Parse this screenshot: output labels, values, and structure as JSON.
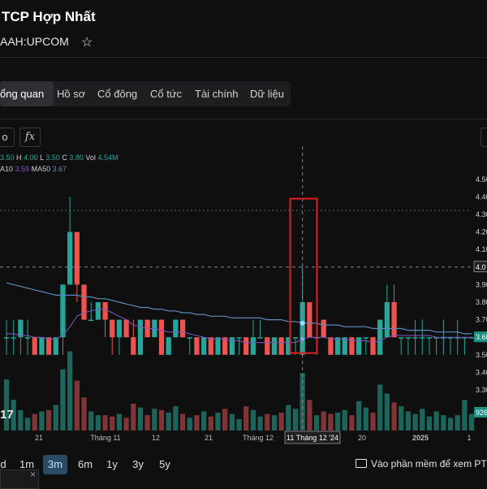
{
  "header": {
    "company_name": "TCP Hợp Nhất",
    "ticker": "AAH:UPCOM",
    "star_icon": "star-outline-icon"
  },
  "tabs": [
    {
      "label": "ổng quan",
      "active": true
    },
    {
      "label": "Hồ sơ",
      "active": false
    },
    {
      "label": "Cổ đông",
      "active": false
    },
    {
      "label": "Cổ tức",
      "active": false
    },
    {
      "label": "Tài chính",
      "active": false
    },
    {
      "label": "Dữ liệu",
      "active": false
    }
  ],
  "toolbar": {
    "left_button": "o",
    "fx_button": "fx"
  },
  "legend": {
    "o_label": "O",
    "o": "3.50",
    "h_label": "H",
    "h": "4.00",
    "l_label": "L",
    "l": "3.50",
    "c_label": "C",
    "c": "3.80",
    "vol_label": "Vol",
    "vol": "4.54M",
    "ma10_label": "A10",
    "ma10": "3.59",
    "ma50_label": "MA50",
    "ma50": "3.67"
  },
  "colors": {
    "up": "#26a69a",
    "down": "#ef5350",
    "ma10": "#7e57c2",
    "ma50": "#5c8ab8",
    "highlight": "#e02020"
  },
  "chart_data": {
    "type": "candlestick",
    "price_axis_ticks": [
      "4.50",
      "4.40",
      "4.30",
      "4.20",
      "4.10",
      "4.00",
      "3.90",
      "3.80",
      "3.70",
      "3.60",
      "3.50",
      "3.40",
      "3.30"
    ],
    "current_price_label": "3.60",
    "crosshair_price_label": "4.0",
    "volume_last_label": "926",
    "time_labels": [
      "21",
      "Tháng 11",
      "12",
      "21",
      "Tháng 12",
      "11 Tháng 12 '24",
      "20",
      "2025",
      "1"
    ],
    "crosshair_date": "11 Tháng 12 '24",
    "ylim": [
      3.3,
      4.55
    ],
    "candles": [
      {
        "o": 3.6,
        "h": 3.7,
        "l": 3.5,
        "c": 3.6,
        "v": 4.0
      },
      {
        "o": 3.6,
        "h": 3.7,
        "l": 3.5,
        "c": 3.6,
        "v": 2.4
      },
      {
        "o": 3.6,
        "h": 3.7,
        "l": 3.5,
        "c": 3.7,
        "v": 1.6
      },
      {
        "o": 3.6,
        "h": 3.7,
        "l": 3.5,
        "c": 3.6,
        "v": 1.0
      },
      {
        "o": 3.6,
        "h": 3.6,
        "l": 3.5,
        "c": 3.5,
        "v": 1.3
      },
      {
        "o": 3.5,
        "h": 3.6,
        "l": 3.5,
        "c": 3.6,
        "v": 1.5
      },
      {
        "o": 3.6,
        "h": 3.6,
        "l": 3.5,
        "c": 3.5,
        "v": 1.6
      },
      {
        "o": 3.5,
        "h": 3.6,
        "l": 3.5,
        "c": 3.6,
        "v": 2.0
      },
      {
        "o": 3.6,
        "h": 3.9,
        "l": 3.5,
        "c": 3.9,
        "v": 4.8
      },
      {
        "o": 3.9,
        "h": 4.4,
        "l": 3.9,
        "c": 4.2,
        "v": 6.2
      },
      {
        "o": 4.2,
        "h": 4.2,
        "l": 3.8,
        "c": 3.9,
        "v": 3.9
      },
      {
        "o": 3.9,
        "h": 3.9,
        "l": 3.7,
        "c": 3.7,
        "v": 2.6
      },
      {
        "o": 3.7,
        "h": 3.8,
        "l": 3.7,
        "c": 3.7,
        "v": 1.5
      },
      {
        "o": 3.7,
        "h": 3.8,
        "l": 3.7,
        "c": 3.8,
        "v": 1.2
      },
      {
        "o": 3.8,
        "h": 3.8,
        "l": 3.6,
        "c": 3.7,
        "v": 1.2
      },
      {
        "o": 3.7,
        "h": 3.7,
        "l": 3.5,
        "c": 3.6,
        "v": 1.1
      },
      {
        "o": 3.6,
        "h": 3.7,
        "l": 3.5,
        "c": 3.7,
        "v": 1.3
      },
      {
        "o": 3.7,
        "h": 3.7,
        "l": 3.6,
        "c": 3.6,
        "v": 1.0
      },
      {
        "o": 3.6,
        "h": 3.7,
        "l": 3.5,
        "c": 3.5,
        "v": 2.1
      },
      {
        "o": 3.5,
        "h": 3.7,
        "l": 3.5,
        "c": 3.7,
        "v": 1.8
      },
      {
        "o": 3.7,
        "h": 3.7,
        "l": 3.6,
        "c": 3.6,
        "v": 1.2
      },
      {
        "o": 3.6,
        "h": 3.7,
        "l": 3.6,
        "c": 3.7,
        "v": 1.7
      },
      {
        "o": 3.7,
        "h": 3.7,
        "l": 3.5,
        "c": 3.5,
        "v": 1.6
      },
      {
        "o": 3.5,
        "h": 3.6,
        "l": 3.5,
        "c": 3.6,
        "v": 1.4
      },
      {
        "o": 3.6,
        "h": 3.7,
        "l": 3.6,
        "c": 3.7,
        "v": 1.9
      },
      {
        "o": 3.7,
        "h": 3.7,
        "l": 3.6,
        "c": 3.6,
        "v": 1.3
      },
      {
        "o": 3.6,
        "h": 3.6,
        "l": 3.5,
        "c": 3.6,
        "v": 1.0
      },
      {
        "o": 3.6,
        "h": 3.6,
        "l": 3.5,
        "c": 3.5,
        "v": 1.2
      },
      {
        "o": 3.5,
        "h": 3.6,
        "l": 3.5,
        "c": 3.6,
        "v": 1.5
      },
      {
        "o": 3.6,
        "h": 3.6,
        "l": 3.5,
        "c": 3.5,
        "v": 1.1
      },
      {
        "o": 3.5,
        "h": 3.6,
        "l": 3.5,
        "c": 3.6,
        "v": 1.4
      },
      {
        "o": 3.6,
        "h": 3.6,
        "l": 3.5,
        "c": 3.5,
        "v": 1.7
      },
      {
        "o": 3.5,
        "h": 3.6,
        "l": 3.5,
        "c": 3.6,
        "v": 1.3
      },
      {
        "o": 3.6,
        "h": 3.6,
        "l": 3.5,
        "c": 3.6,
        "v": 0.9
      },
      {
        "o": 3.6,
        "h": 3.6,
        "l": 3.5,
        "c": 3.5,
        "v": 1.9
      },
      {
        "o": 3.5,
        "h": 3.7,
        "l": 3.5,
        "c": 3.6,
        "v": 1.6
      },
      {
        "o": 3.6,
        "h": 3.7,
        "l": 3.6,
        "c": 3.6,
        "v": 1.1
      },
      {
        "o": 3.6,
        "h": 3.6,
        "l": 3.5,
        "c": 3.5,
        "v": 1.3
      },
      {
        "o": 3.5,
        "h": 3.6,
        "l": 3.5,
        "c": 3.6,
        "v": 1.2
      },
      {
        "o": 3.6,
        "h": 3.6,
        "l": 3.5,
        "c": 3.5,
        "v": 1.4
      },
      {
        "o": 3.5,
        "h": 3.6,
        "l": 3.5,
        "c": 3.6,
        "v": 2.0
      },
      {
        "o": 3.6,
        "h": 3.6,
        "l": 3.5,
        "c": 3.6,
        "v": 1.7
      },
      {
        "o": 3.5,
        "h": 4.0,
        "l": 3.5,
        "c": 3.8,
        "v": 4.5
      },
      {
        "o": 3.8,
        "h": 3.8,
        "l": 3.6,
        "c": 3.6,
        "v": 2.4
      },
      {
        "o": 3.6,
        "h": 3.6,
        "l": 3.5,
        "c": 3.6,
        "v": 1.2
      },
      {
        "o": 3.7,
        "h": 3.7,
        "l": 3.6,
        "c": 3.6,
        "v": 1.5
      },
      {
        "o": 3.6,
        "h": 3.6,
        "l": 3.5,
        "c": 3.5,
        "v": 1.3
      },
      {
        "o": 3.5,
        "h": 3.6,
        "l": 3.5,
        "c": 3.6,
        "v": 1.4
      },
      {
        "o": 3.5,
        "h": 3.6,
        "l": 3.5,
        "c": 3.6,
        "v": 1.6
      },
      {
        "o": 3.6,
        "h": 3.6,
        "l": 3.5,
        "c": 3.5,
        "v": 1.2
      },
      {
        "o": 3.5,
        "h": 3.6,
        "l": 3.5,
        "c": 3.6,
        "v": 2.3
      },
      {
        "o": 3.6,
        "h": 3.6,
        "l": 3.5,
        "c": 3.6,
        "v": 1.8
      },
      {
        "o": 3.6,
        "h": 3.6,
        "l": 3.5,
        "c": 3.5,
        "v": 1.4
      },
      {
        "o": 3.5,
        "h": 3.7,
        "l": 3.5,
        "c": 3.7,
        "v": 3.6
      },
      {
        "o": 3.6,
        "h": 3.9,
        "l": 3.6,
        "c": 3.8,
        "v": 2.9
      },
      {
        "o": 3.8,
        "h": 3.9,
        "l": 3.6,
        "c": 3.6,
        "v": 2.2
      },
      {
        "o": 3.6,
        "h": 3.6,
        "l": 3.5,
        "c": 3.6,
        "v": 1.9
      },
      {
        "o": 3.6,
        "h": 3.6,
        "l": 3.5,
        "c": 3.6,
        "v": 1.5
      },
      {
        "o": 3.6,
        "h": 3.7,
        "l": 3.5,
        "c": 3.6,
        "v": 1.3
      },
      {
        "o": 3.6,
        "h": 3.7,
        "l": 3.5,
        "c": 3.6,
        "v": 1.7
      },
      {
        "o": 3.6,
        "h": 3.6,
        "l": 3.5,
        "c": 3.6,
        "v": 1.1
      },
      {
        "o": 3.6,
        "h": 3.6,
        "l": 3.5,
        "c": 3.6,
        "v": 1.5
      },
      {
        "o": 3.6,
        "h": 3.7,
        "l": 3.5,
        "c": 3.6,
        "v": 1.2
      },
      {
        "o": 3.6,
        "h": 3.6,
        "l": 3.5,
        "c": 3.6,
        "v": 1.0
      },
      {
        "o": 3.6,
        "h": 3.7,
        "l": 3.5,
        "c": 3.6,
        "v": 1.2
      },
      {
        "o": 3.6,
        "h": 3.6,
        "l": 3.5,
        "c": 3.6,
        "v": 2.4
      },
      {
        "o": 3.6,
        "h": 3.6,
        "l": 3.6,
        "c": 3.6,
        "v": 1.3
      }
    ],
    "ma10": [
      3.62,
      3.62,
      3.61,
      3.61,
      3.6,
      3.6,
      3.59,
      3.59,
      3.61,
      3.66,
      3.72,
      3.74,
      3.75,
      3.76,
      3.76,
      3.74,
      3.72,
      3.7,
      3.67,
      3.66,
      3.65,
      3.65,
      3.64,
      3.63,
      3.63,
      3.63,
      3.62,
      3.61,
      3.6,
      3.59,
      3.59,
      3.59,
      3.58,
      3.58,
      3.57,
      3.57,
      3.57,
      3.57,
      3.57,
      3.57,
      3.57,
      3.57,
      3.59,
      3.6,
      3.6,
      3.6,
      3.59,
      3.59,
      3.59,
      3.58,
      3.58,
      3.58,
      3.57,
      3.58,
      3.6,
      3.61,
      3.61,
      3.61,
      3.61,
      3.61,
      3.61,
      3.6,
      3.6,
      3.6,
      3.6,
      3.6,
      3.6
    ],
    "ma50": [
      3.91,
      3.9,
      3.89,
      3.88,
      3.87,
      3.86,
      3.85,
      3.84,
      3.84,
      3.84,
      3.84,
      3.83,
      3.83,
      3.82,
      3.82,
      3.81,
      3.8,
      3.79,
      3.78,
      3.77,
      3.77,
      3.76,
      3.76,
      3.75,
      3.75,
      3.74,
      3.74,
      3.73,
      3.73,
      3.72,
      3.72,
      3.72,
      3.71,
      3.71,
      3.71,
      3.71,
      3.71,
      3.7,
      3.7,
      3.7,
      3.69,
      3.69,
      3.68,
      3.68,
      3.68,
      3.67,
      3.67,
      3.67,
      3.66,
      3.66,
      3.66,
      3.66,
      3.65,
      3.65,
      3.65,
      3.65,
      3.65,
      3.64,
      3.64,
      3.64,
      3.64,
      3.63,
      3.63,
      3.63,
      3.63,
      3.62,
      3.62
    ]
  },
  "ranges": [
    {
      "label": "d",
      "active": false
    },
    {
      "label": "1m",
      "active": false
    },
    {
      "label": "3m",
      "active": true
    },
    {
      "label": "6m",
      "active": false
    },
    {
      "label": "1y",
      "active": false
    },
    {
      "label": "3y",
      "active": false
    },
    {
      "label": "5y",
      "active": false
    }
  ],
  "footer": {
    "pti_text": "Vào phần mềm để xem PTI",
    "pti_icon": "monitor-icon",
    "mini_close": "×",
    "watermark": "17"
  }
}
